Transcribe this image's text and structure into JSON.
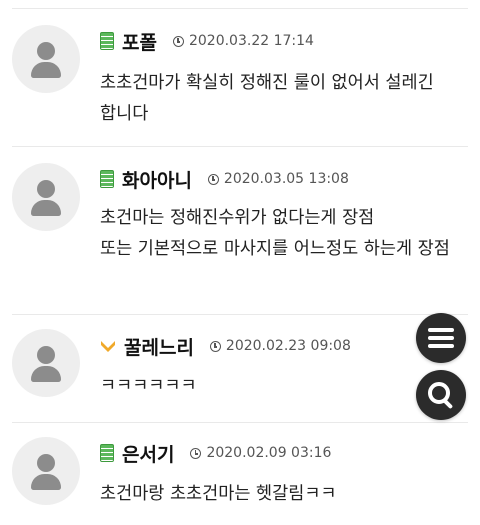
{
  "comments": [
    {
      "nickname": "포폴",
      "level": "green",
      "date": "2020.03.22 17:14",
      "text": "초초건마가 확실히 정해진 룰이 없어서 설레긴 합니다"
    },
    {
      "nickname": "화아아니",
      "level": "green",
      "date": "2020.03.05 13:08",
      "text": "초건마는 정해진수위가 없다는게 장점\n또는 기본적으로 마사지를 어느정도 하는게 장점"
    },
    {
      "nickname": "꿀레느리",
      "level": "gold",
      "date": "2020.02.23 09:08",
      "text": "ㅋㅋㅋㅋㅋㅋ"
    },
    {
      "nickname": "은서기",
      "level": "green",
      "date": "2020.02.09 03:16",
      "text": "초건마랑 초초건마는 헷갈림ㅋㅋ"
    }
  ],
  "floating_buttons": {
    "menu_icon": "hamburger-menu-icon",
    "search_icon": "search-icon",
    "background": "#2b2b2b"
  },
  "colors": {
    "level_green": "#5cb85c",
    "level_gold": "#f0a92a",
    "divider": "#e9e9e9",
    "avatar_bg": "#eeeeee"
  }
}
